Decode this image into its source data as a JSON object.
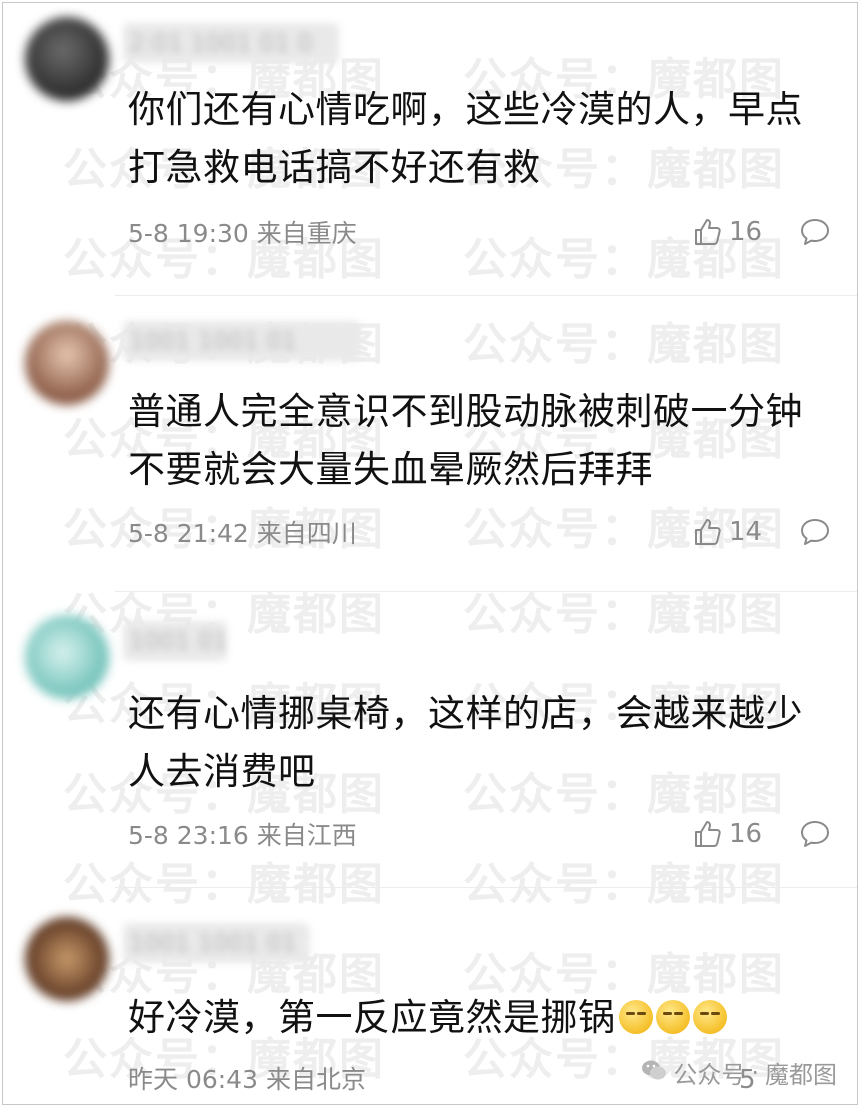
{
  "watermark": "公众号：魔都图",
  "comments": [
    {
      "username": "2:01 1001 01 0",
      "content": "你们还有心情吃啊，这些冷漠的人，早点打急救电话搞不好还有救",
      "time": "5-8 19:30",
      "location": "来自重庆",
      "likes": "16"
    },
    {
      "username": "1001 1001 01",
      "content": "普通人完全意识不到股动脉被刺破一分钟不要就会大量失血晕厥然后拜拜",
      "time": "5-8 21:42",
      "location": "来自四川",
      "likes": "14"
    },
    {
      "username": "1001 01",
      "content": "还有心情挪桌椅，这样的店，会越来越少人去消费吧",
      "time": "5-8 23:16",
      "location": "来自江西",
      "likes": "16"
    },
    {
      "username": "1001 1001 01 1",
      "content": "好冷漠，第一反应竟然是挪锅",
      "time": "昨天 06:43",
      "location": "来自北京",
      "likes": "5"
    }
  ],
  "footer": {
    "account_label": "公众号",
    "account_name": "魔都图"
  },
  "colors": {
    "meta": "#8a8a8a",
    "text": "#111111"
  }
}
